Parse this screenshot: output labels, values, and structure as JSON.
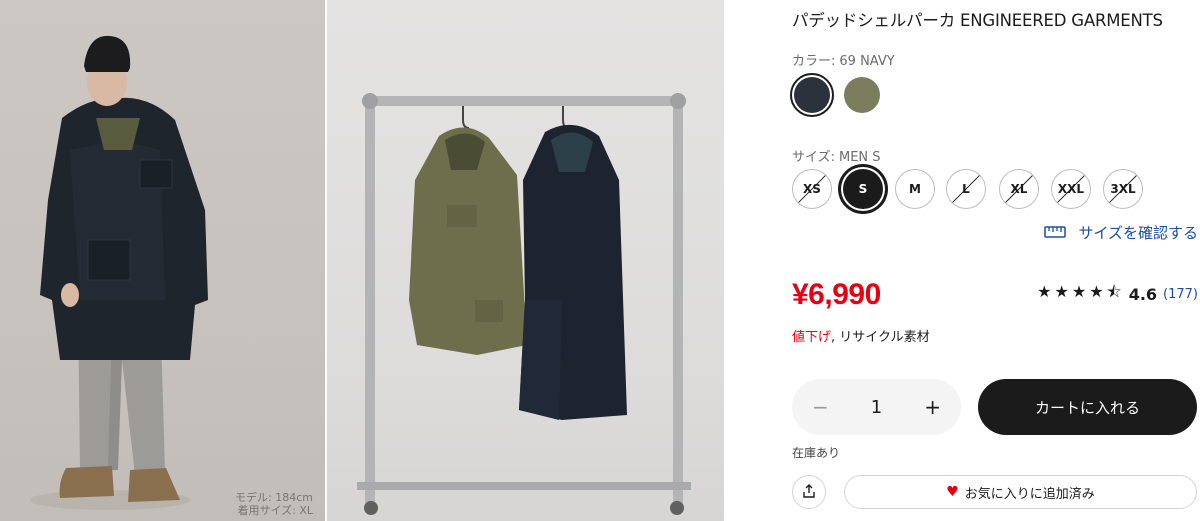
{
  "product": {
    "title": "パデッドシェルパーカ ENGINEERED GARMENTS"
  },
  "images": {
    "model_caption_line1": "モデル: 184cm",
    "model_caption_line2": "着用サイズ: XL"
  },
  "color": {
    "label": "カラー:",
    "selected": "69 NAVY",
    "options": [
      {
        "name": "navy",
        "hex": "#2b323b",
        "selected": true
      },
      {
        "name": "olive",
        "hex": "#7c7d5c",
        "selected": false
      }
    ]
  },
  "size": {
    "label": "サイズ:",
    "selected": "MEN S",
    "options": [
      {
        "label": "XS",
        "available": false
      },
      {
        "label": "S",
        "available": true,
        "selected": true
      },
      {
        "label": "M",
        "available": true
      },
      {
        "label": "L",
        "available": false
      },
      {
        "label": "XL",
        "available": false
      },
      {
        "label": "XXL",
        "available": false
      },
      {
        "label": "3XL",
        "available": false
      }
    ],
    "guide_label": "サイズを確認する",
    "guide_icon": "ruler-icon"
  },
  "price": {
    "value": "¥6,990",
    "note_red": "値下げ",
    "note_sep": ",",
    "note_rest": "リサイクル素材"
  },
  "rating": {
    "stars": 4.6,
    "stars_text": "★★★★⯪",
    "value": "4.6",
    "count": "(177)"
  },
  "cart": {
    "quantity": "1",
    "minus": "−",
    "plus": "+",
    "add_label": "カートに入れる",
    "stock_label": "在庫あり"
  },
  "actions": {
    "share_icon": "share-icon",
    "favorite_icon": "heart-icon",
    "favorite_label": "お気に入りに追加済み"
  },
  "colors": {
    "price_red": "#e60012",
    "link_blue": "#1a4ea8",
    "button_dark": "#1b1b1b"
  }
}
